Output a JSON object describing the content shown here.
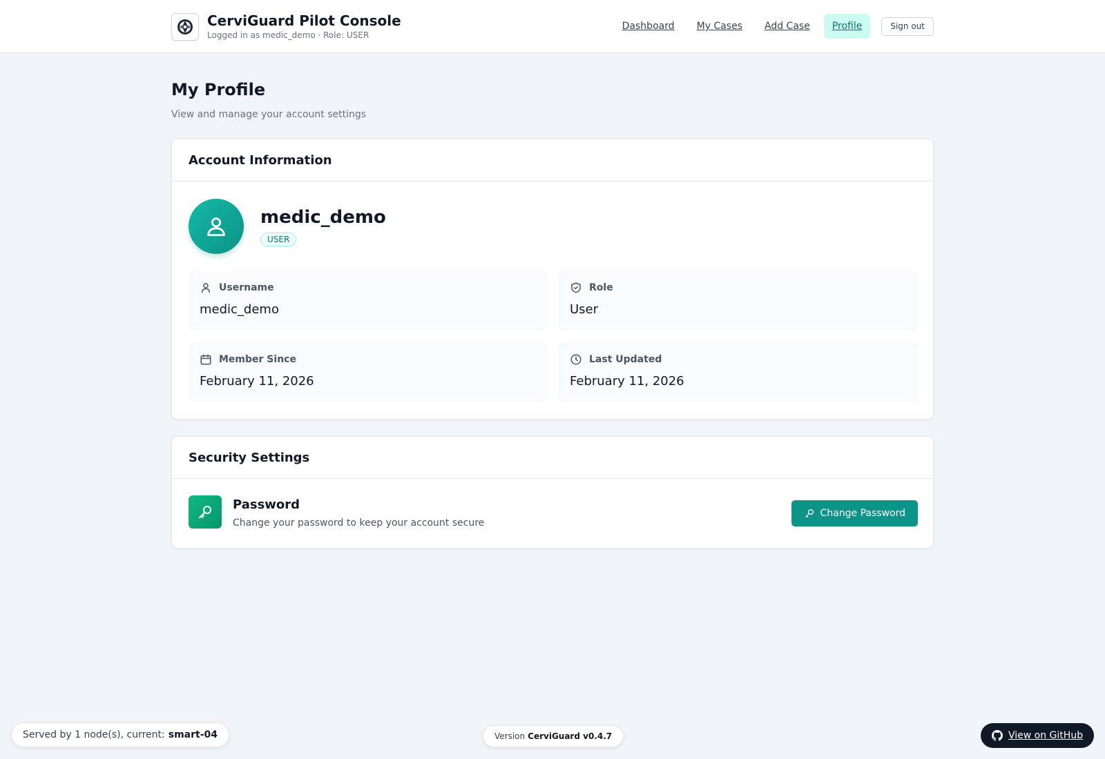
{
  "header": {
    "title": "CerviGuard Pilot Console",
    "subtitle": "Logged in as medic_demo · Role: USER",
    "nav": [
      {
        "label": "Dashboard",
        "active": false
      },
      {
        "label": "My Cases",
        "active": false
      },
      {
        "label": "Add Case",
        "active": false
      },
      {
        "label": "Profile",
        "active": true
      }
    ],
    "signout_label": "Sign out"
  },
  "page": {
    "title": "My Profile",
    "subtitle": "View and manage your account settings"
  },
  "account": {
    "heading": "Account Information",
    "name": "medic_demo",
    "role_badge": "USER",
    "fields": {
      "username": {
        "label": "Username",
        "value": "medic_demo",
        "icon": "user-icon"
      },
      "role": {
        "label": "Role",
        "value": "User",
        "icon": "shield-icon"
      },
      "member_since": {
        "label": "Member Since",
        "value": "February 11, 2026",
        "icon": "calendar-icon"
      },
      "last_updated": {
        "label": "Last Updated",
        "value": "February 11, 2026",
        "icon": "clock-icon"
      }
    }
  },
  "security": {
    "heading": "Security Settings",
    "password_title": "Password",
    "password_desc": "Change your password to keep your account secure",
    "change_label": "Change Password"
  },
  "footer": {
    "served_prefix": "Served by 1 node(s), current:",
    "served_node": "smart-04",
    "version_prefix": "Version",
    "version_value": "CerviGuard v0.4.7",
    "github_label": "View on GitHub"
  },
  "colors": {
    "accent": "#0d9488",
    "accent_light": "#ccfbf1",
    "background": "#f1f4f8",
    "text": "#111827"
  }
}
